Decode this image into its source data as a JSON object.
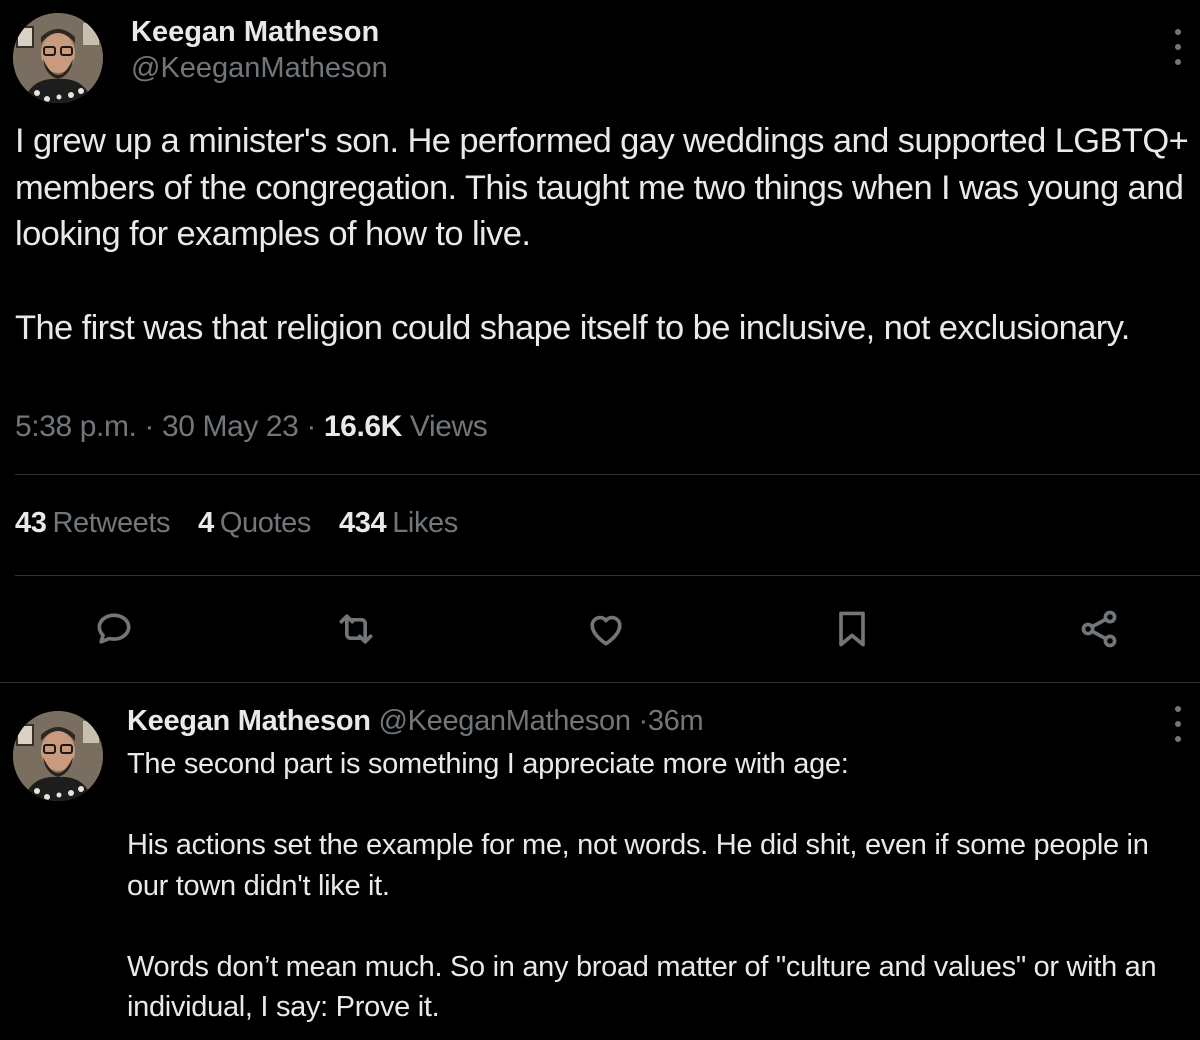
{
  "tweet": {
    "author_name": "Keegan Matheson",
    "author_handle": "@KeeganMatheson",
    "paragraphs": [
      "I grew up a minister's son. He performed gay weddings and supported LGBTQ+ members of the congregation. This taught me two things when I was young and looking for examples of how to live.",
      "The first was that religion could shape itself to be inclusive, not exclusionary."
    ],
    "time": "5:38 p.m.",
    "separator": "·",
    "date": "30 May 23",
    "views_count": "16.6K",
    "views_label": "Views",
    "stats": {
      "retweets_count": "43",
      "retweets_label": "Retweets",
      "quotes_count": "4",
      "quotes_label": "Quotes",
      "likes_count": "434",
      "likes_label": "Likes"
    },
    "actions": [
      "reply-icon",
      "retweet-icon",
      "like-icon",
      "bookmark-icon",
      "share-icon"
    ]
  },
  "reply": {
    "author_name": "Keegan Matheson",
    "author_handle": "@KeeganMatheson",
    "separator": "·",
    "time_ago": "36m",
    "paragraphs": [
      "The second part is something I appreciate more with age:",
      "His actions set the example for me, not words. He did shit, even if some people in our town didn't like it.",
      "Words don’t mean much. So in any broad matter of \"culture and values\" or with an individual, I say: Prove it."
    ]
  },
  "colors": {
    "background": "#000000",
    "text_primary": "#e7e9ea",
    "text_secondary": "#71767b",
    "divider": "#2f3336"
  }
}
